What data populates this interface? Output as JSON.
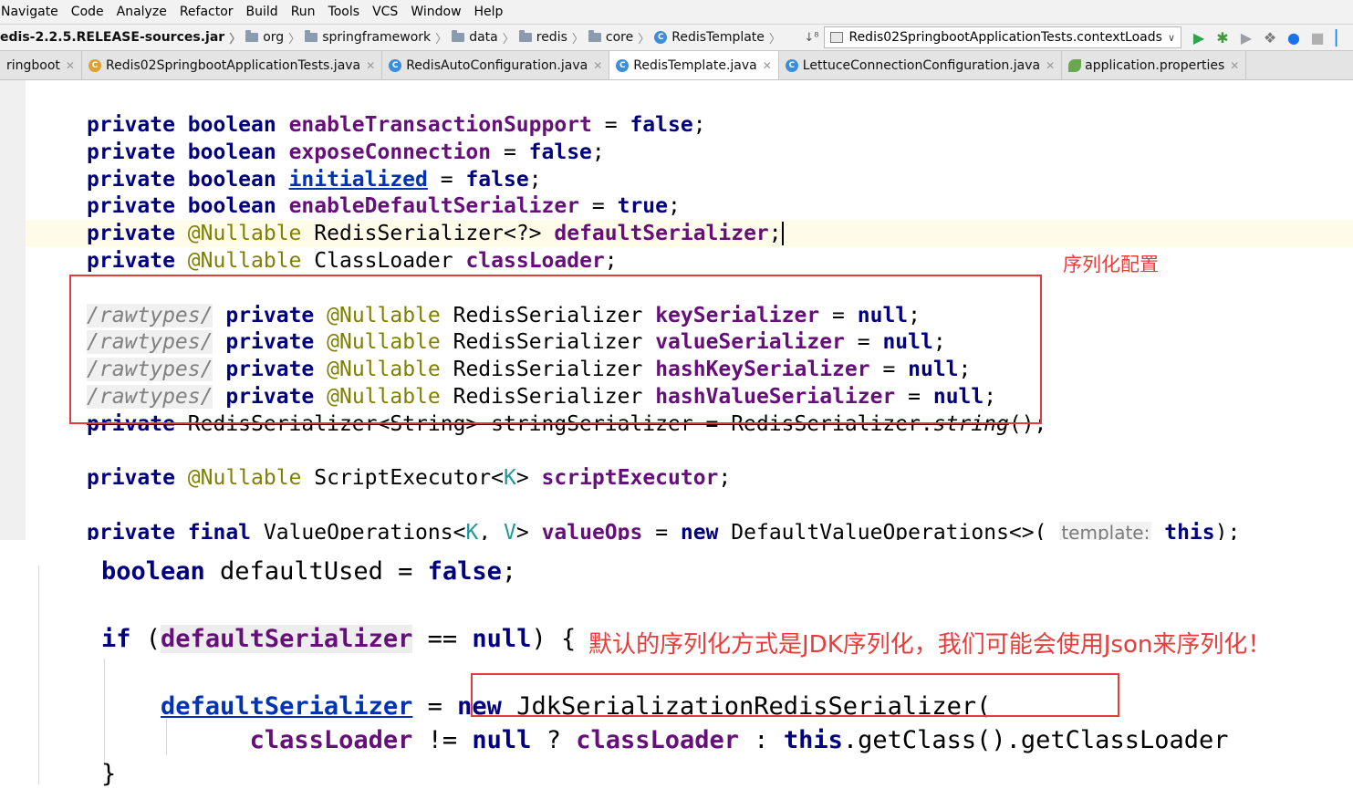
{
  "menu": [
    "Navigate",
    "Code",
    "Analyze",
    "Refactor",
    "Build",
    "Run",
    "Tools",
    "VCS",
    "Window",
    "Help"
  ],
  "breadcrumb": {
    "jar": "edis-2.2.5.RELEASE-sources.jar",
    "folders": [
      "org",
      "springframework",
      "data",
      "redis",
      "core"
    ],
    "class_name": "RedisTemplate"
  },
  "run_config": {
    "label": "Redis02SpringbootApplicationTests.contextLoads"
  },
  "tabs": [
    {
      "label": "ringboot",
      "active": false
    },
    {
      "label": "Redis02SpringbootApplicationTests.java",
      "active": false
    },
    {
      "label": "RedisAutoConfiguration.java",
      "active": false
    },
    {
      "label": "RedisTemplate.java",
      "active": true
    },
    {
      "label": "LettuceConnectionConfiguration.java",
      "active": false
    },
    {
      "label": "application.properties",
      "active": false
    }
  ],
  "code1": {
    "l1_field": "enableTransactionSupport",
    "l2_field": "exposeConnection",
    "l3_field": "initialized",
    "l4_field": "enableDefaultSerializer",
    "l5_type": "RedisSerializer<?>",
    "l5_field": "defaultSerializer",
    "l6_type": "ClassLoader",
    "l6_field": "classLoader",
    "raw_comment": "/rawtypes/",
    "serializer_type": "RedisSerializer",
    "s1_field": "keySerializer",
    "s2_field": "valueSerializer",
    "s3_field": "hashKeySerializer",
    "s4_field": "hashValueSerializer",
    "l11_text": "RedisSerializer<String> stringSerializer = RedisSerializer.",
    "l11_method": "string",
    "l12_type": "ScriptExecutor<",
    "l12_field": "scriptExecutor",
    "l13_type": "ValueOperations<",
    "l13_field": "valueOps",
    "l13_ctor": "DefaultValueOperations<>(",
    "l13_hint": "template:"
  },
  "notes": {
    "serialization_config": "序列化配置",
    "default_jdk": "默认的序列化方式是JDK序列化，我们可能会使用Json来序列化！"
  },
  "code2": {
    "var_used": "defaultUsed",
    "field_default": "defaultSerializer",
    "ctor": "JdkSerializationRedisSerializer(",
    "field_loader": "classLoader",
    "getter": ".getClass().getClassLoader"
  }
}
